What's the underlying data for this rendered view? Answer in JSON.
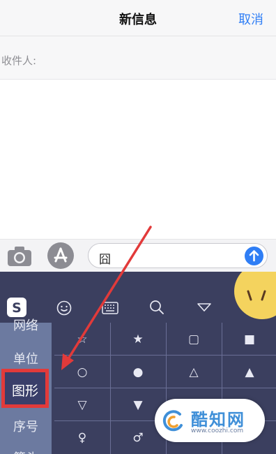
{
  "header": {
    "title": "新信息",
    "cancel_label": "取消"
  },
  "recipient": {
    "label": "收件人:"
  },
  "input": {
    "value": "囧"
  },
  "keyboard": {
    "sidebar": [
      "网络",
      "单位",
      "图形",
      "序号",
      "箭头"
    ],
    "active_category": "图形",
    "symbols": [
      [
        "☆",
        "★",
        "▢",
        "■"
      ],
      [
        "○",
        "●",
        "△",
        "▲"
      ],
      [
        "▽",
        "▼",
        "",
        ""
      ],
      [
        "♀",
        "♂",
        "",
        ""
      ]
    ]
  },
  "watermark": {
    "brand": "酷知网",
    "site": "www.coozhi.com"
  },
  "colors": {
    "accent": "#2f7ef5",
    "keyboard_bg": "#3b3f5f",
    "highlight": "#e23a3a"
  }
}
